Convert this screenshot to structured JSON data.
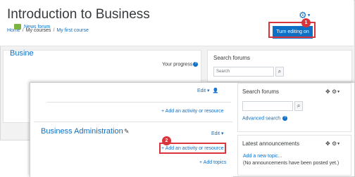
{
  "header": {
    "title": "Introduction to Business",
    "breadcrumb": [
      "Home",
      "My courses",
      "My first course"
    ],
    "breadcrumb_sep": "/",
    "edit_button_label": "Turn editing on",
    "gear_icon": "gear-icon"
  },
  "callouts": {
    "step1": "1",
    "step2": "2"
  },
  "back_page": {
    "progress_label": "Your progress",
    "help_icon_glyph": "?",
    "news_forum_label": "News forum",
    "section_title_partial": "Busine"
  },
  "back_sidebar": {
    "search_title": "Search forums",
    "search_placeholder": "Search"
  },
  "front_main": {
    "edit_label": "Edit",
    "add_activity_label": "Add an activity or resource",
    "section_title": "Business Administration",
    "add_topics_label": "Add topics",
    "plus_glyph": "+"
  },
  "front_sidebar": {
    "search_title": "Search forums",
    "search_placeholder": "",
    "advanced_search_label": "Advanced search",
    "help_glyph": "?",
    "announcements_title": "Latest announcements",
    "add_topic_label": "Add a new topic...",
    "no_announcements_text": "(No announcements have been posted yet.)"
  },
  "colors": {
    "link": "#0f6fc5",
    "primary_button": "#0f6fc5",
    "highlight": "#d9353d",
    "text": "#373a3c"
  }
}
